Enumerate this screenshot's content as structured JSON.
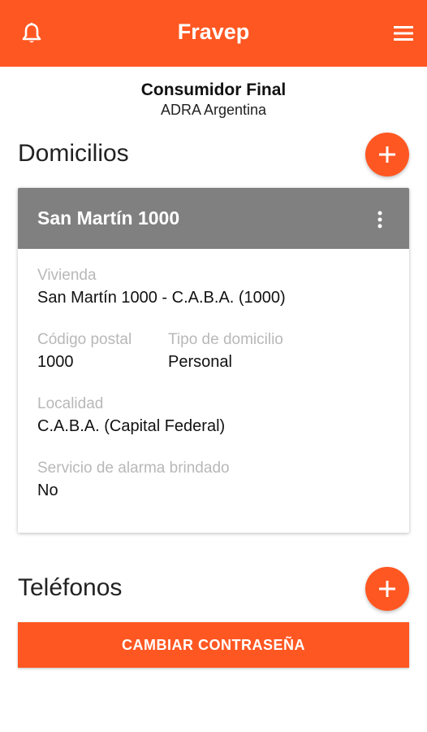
{
  "app": {
    "title": "Fravep",
    "brand_color": "#ff5722"
  },
  "icons": {
    "notifications": "bell-icon",
    "menu": "hamburger-menu-icon",
    "more": "more-vert-icon",
    "add": "plus-icon"
  },
  "user": {
    "name": "Consumidor Final",
    "org": "ADRA Argentina"
  },
  "domicilios": {
    "title": "Domicilios",
    "card": {
      "title": "San Martín 1000",
      "fields": {
        "vivienda": {
          "label": "Vivienda",
          "value": "San Martín 1000 - C.A.B.A. (1000)"
        },
        "codigo_postal": {
          "label": "Código postal",
          "value": "1000"
        },
        "tipo_domicilio": {
          "label": "Tipo de domicilio",
          "value": "Personal"
        },
        "localidad": {
          "label": "Localidad",
          "value": "C.A.B.A. (Capital Federal)"
        },
        "alarma": {
          "label": "Servicio de alarma brindado",
          "value": "No"
        }
      }
    }
  },
  "telefonos": {
    "title": "Teléfonos"
  },
  "actions": {
    "change_password": "CAMBIAR CONTRASEÑA"
  }
}
